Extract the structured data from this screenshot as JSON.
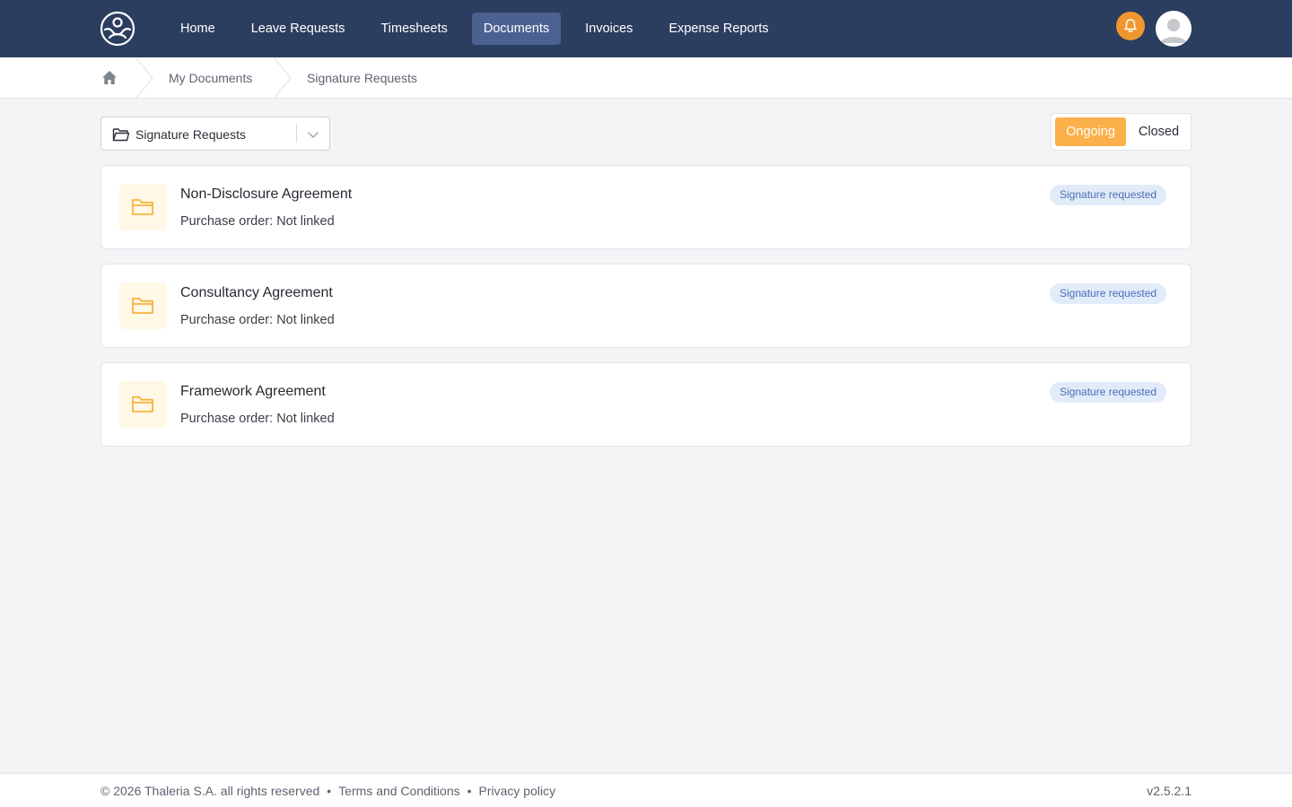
{
  "nav": {
    "items": [
      {
        "label": "Home",
        "active": false
      },
      {
        "label": "Leave Requests",
        "active": false
      },
      {
        "label": "Timesheets",
        "active": false
      },
      {
        "label": "Documents",
        "active": true
      },
      {
        "label": "Invoices",
        "active": false
      },
      {
        "label": "Expense Reports",
        "active": false
      }
    ],
    "icons": {
      "logo": "user-circle-logo-icon",
      "notifications": "bell-icon",
      "avatar": "user-avatar-icon"
    }
  },
  "breadcrumb": {
    "home_icon": "home-icon",
    "items": [
      "My Documents",
      "Signature Requests"
    ]
  },
  "folder_select": {
    "icon": "folder-open-icon",
    "value": "Signature Requests"
  },
  "status_toggle": {
    "ongoing": "Ongoing",
    "closed": "Closed",
    "selected": "Ongoing"
  },
  "documents": [
    {
      "title": "Non-Disclosure Agreement",
      "purchase_order": "Purchase order: Not linked",
      "status": "Signature requested"
    },
    {
      "title": "Consultancy Agreement",
      "purchase_order": "Purchase order: Not linked",
      "status": "Signature requested"
    },
    {
      "title": "Framework Agreement",
      "purchase_order": "Purchase order: Not linked",
      "status": "Signature requested"
    }
  ],
  "footer": {
    "copyright": "© 2026 Thaleria S.A. all rights reserved",
    "separator": "•",
    "terms": "Terms and Conditions",
    "privacy": "Privacy policy",
    "version": "v2.5.2.1"
  },
  "colors": {
    "nav_bg": "#2c3e5f",
    "nav_active": "#4b6290",
    "accent_orange": "#fbb04a",
    "bell": "#f0962f",
    "badge_bg": "#e2ebfa",
    "badge_text": "#4a6fb4"
  }
}
